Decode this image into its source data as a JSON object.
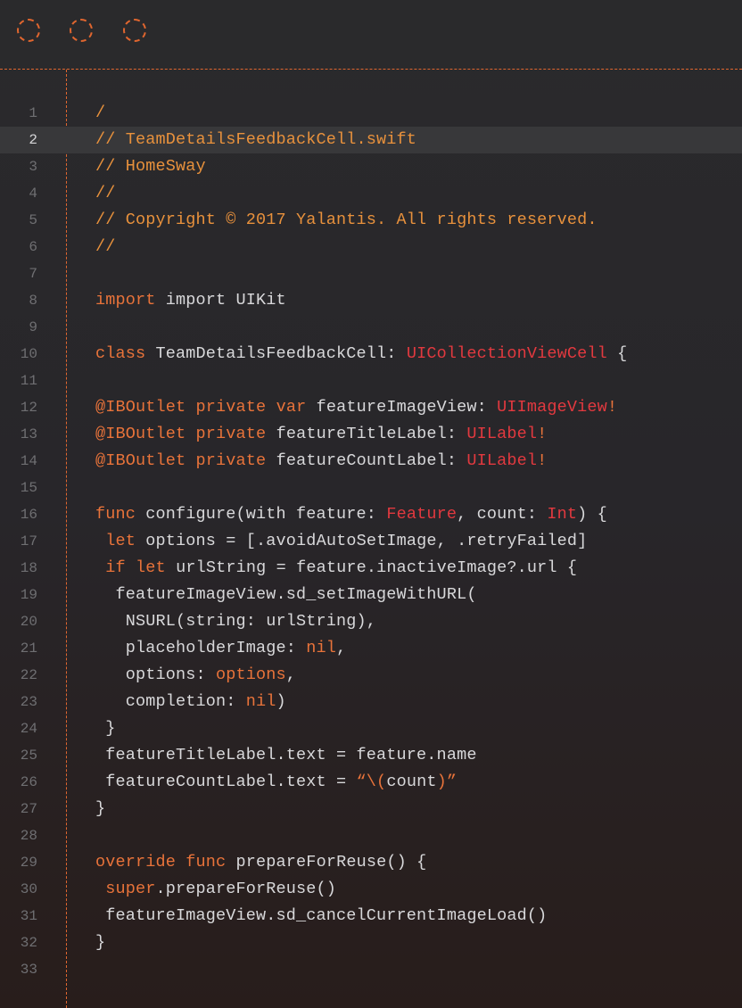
{
  "window": {
    "controls": [
      "close-control",
      "minimize-control",
      "zoom-control"
    ]
  },
  "editor": {
    "lines": [
      {
        "n": "1",
        "tokens": [
          {
            "t": "/",
            "c": "cm"
          }
        ]
      },
      {
        "n": "2",
        "highlight": true,
        "tokens": [
          {
            "t": "// TeamDetailsFeedbackCell.swift",
            "c": "cm"
          }
        ]
      },
      {
        "n": "3",
        "tokens": [
          {
            "t": "// HomeSway",
            "c": "cm"
          }
        ]
      },
      {
        "n": "4",
        "tokens": [
          {
            "t": "//",
            "c": "cm"
          }
        ]
      },
      {
        "n": "5",
        "tokens": [
          {
            "t": "// Copyright © 2017 Yalantis. All rights reserved.",
            "c": "cm"
          }
        ]
      },
      {
        "n": "6",
        "tokens": [
          {
            "t": "//",
            "c": "cm"
          }
        ]
      },
      {
        "n": "7",
        "tokens": []
      },
      {
        "n": "8",
        "tokens": [
          {
            "t": "import",
            "c": "kw"
          },
          {
            "t": " import UIKit",
            "c": ""
          }
        ]
      },
      {
        "n": "9",
        "tokens": []
      },
      {
        "n": "10",
        "tokens": [
          {
            "t": "class",
            "c": "kw"
          },
          {
            "t": " TeamDetailsFeedbackCell: ",
            "c": ""
          },
          {
            "t": "UICollectionViewCell",
            "c": "ty"
          },
          {
            "t": " {",
            "c": ""
          }
        ]
      },
      {
        "n": "11",
        "tokens": []
      },
      {
        "n": "12",
        "tokens": [
          {
            "t": "@IBOutlet",
            "c": "at"
          },
          {
            "t": " ",
            "c": ""
          },
          {
            "t": "private",
            "c": "kw"
          },
          {
            "t": " ",
            "c": ""
          },
          {
            "t": "var",
            "c": "kw"
          },
          {
            "t": " featureImageView: ",
            "c": ""
          },
          {
            "t": "UIImageView",
            "c": "ty"
          },
          {
            "t": "!",
            "c": "kw"
          }
        ]
      },
      {
        "n": "13",
        "tokens": [
          {
            "t": "@IBOutlet",
            "c": "at"
          },
          {
            "t": " ",
            "c": ""
          },
          {
            "t": "private",
            "c": "kw"
          },
          {
            "t": " featureTitleLabel: ",
            "c": ""
          },
          {
            "t": "UILabel",
            "c": "ty"
          },
          {
            "t": "!",
            "c": "kw"
          }
        ]
      },
      {
        "n": "14",
        "tokens": [
          {
            "t": "@IBOutlet",
            "c": "at"
          },
          {
            "t": " ",
            "c": ""
          },
          {
            "t": "private",
            "c": "kw"
          },
          {
            "t": " featureCountLabel: ",
            "c": ""
          },
          {
            "t": "UILabel",
            "c": "ty"
          },
          {
            "t": "!",
            "c": "kw"
          }
        ]
      },
      {
        "n": "15",
        "tokens": []
      },
      {
        "n": "16",
        "tokens": [
          {
            "t": "func",
            "c": "kw"
          },
          {
            "t": " configure(with feature: ",
            "c": ""
          },
          {
            "t": "Feature",
            "c": "ty"
          },
          {
            "t": ", count: ",
            "c": ""
          },
          {
            "t": "Int",
            "c": "ty"
          },
          {
            "t": ") {",
            "c": ""
          }
        ]
      },
      {
        "n": "17",
        "tokens": [
          {
            "t": " ",
            "c": ""
          },
          {
            "t": "let",
            "c": "kw"
          },
          {
            "t": " options = [.avoidAutoSetImage, .retryFailed]",
            "c": ""
          }
        ]
      },
      {
        "n": "18",
        "tokens": [
          {
            "t": " ",
            "c": ""
          },
          {
            "t": "if",
            "c": "kw"
          },
          {
            "t": " ",
            "c": ""
          },
          {
            "t": "let",
            "c": "kw"
          },
          {
            "t": " urlString = feature.inactiveImage?.url {",
            "c": ""
          }
        ]
      },
      {
        "n": "19",
        "tokens": [
          {
            "t": "  featureImageView.sd_setImageWithURL(",
            "c": ""
          }
        ]
      },
      {
        "n": "20",
        "tokens": [
          {
            "t": "   NSURL(string: urlString),",
            "c": ""
          }
        ]
      },
      {
        "n": "21",
        "tokens": [
          {
            "t": "   placeholderImage: ",
            "c": ""
          },
          {
            "t": "nil",
            "c": "kw"
          },
          {
            "t": ",",
            "c": ""
          }
        ]
      },
      {
        "n": "22",
        "tokens": [
          {
            "t": "   options: ",
            "c": ""
          },
          {
            "t": "options",
            "c": "kw"
          },
          {
            "t": ",",
            "c": ""
          }
        ]
      },
      {
        "n": "23",
        "tokens": [
          {
            "t": "   completion: ",
            "c": ""
          },
          {
            "t": "nil",
            "c": "kw"
          },
          {
            "t": ")",
            "c": ""
          }
        ]
      },
      {
        "n": "24",
        "tokens": [
          {
            "t": " }",
            "c": ""
          }
        ]
      },
      {
        "n": "25",
        "tokens": [
          {
            "t": " featureTitleLabel.text = feature.name",
            "c": ""
          }
        ]
      },
      {
        "n": "26",
        "tokens": [
          {
            "t": " featureCountLabel.text = ",
            "c": ""
          },
          {
            "t": "“\\(",
            "c": "kw"
          },
          {
            "t": "count",
            "c": ""
          },
          {
            "t": ")”",
            "c": "kw"
          }
        ]
      },
      {
        "n": "27",
        "tokens": [
          {
            "t": "}",
            "c": ""
          }
        ]
      },
      {
        "n": "28",
        "tokens": []
      },
      {
        "n": "29",
        "tokens": [
          {
            "t": "override",
            "c": "kw"
          },
          {
            "t": " ",
            "c": ""
          },
          {
            "t": "func",
            "c": "kw"
          },
          {
            "t": " prepareForReuse() {",
            "c": ""
          }
        ]
      },
      {
        "n": "30",
        "tokens": [
          {
            "t": " ",
            "c": ""
          },
          {
            "t": "super",
            "c": "kw"
          },
          {
            "t": ".prepareForReuse()",
            "c": ""
          }
        ]
      },
      {
        "n": "31",
        "tokens": [
          {
            "t": " featureImageView.sd_cancelCurrentImageLoad()",
            "c": ""
          }
        ]
      },
      {
        "n": "32",
        "tokens": [
          {
            "t": "}",
            "c": ""
          }
        ]
      },
      {
        "n": "33",
        "tokens": []
      }
    ]
  },
  "colors": {
    "accent": "#e0662f",
    "keyword": "#e8733a",
    "type": "#e2393f",
    "comment": "#e8913c",
    "text": "#d8d8da",
    "line_number": "#6f6f72",
    "highlight_line": "#38383a"
  }
}
